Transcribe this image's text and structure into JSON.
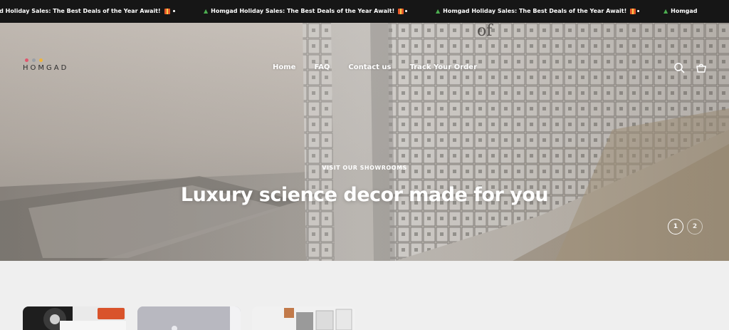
{
  "announcement": {
    "items": [
      {
        "text": "gad Holiday Sales: The Best Deals of the Year Await!"
      },
      {
        "text": "Homgad Holiday Sales: The Best Deals of the Year Await!"
      },
      {
        "text": "Homgad Holiday Sales: The Best Deals of the Year Await!"
      },
      {
        "text": "Homgad"
      }
    ]
  },
  "header": {
    "logo_text": "HOMGAD",
    "logo_dot_colors": [
      "#e0566d",
      "#9aa0a6",
      "#f0b43c"
    ],
    "nav": [
      {
        "label": "Home"
      },
      {
        "label": "FAQ"
      },
      {
        "label": "Contact us"
      },
      {
        "label": "Track Your Order"
      }
    ],
    "icons": [
      "search-icon",
      "cart-icon"
    ]
  },
  "hero": {
    "eyebrow": "VISIT OUR SHOWROOMS",
    "headline": "Luxury science decor made for you",
    "slides": [
      {
        "label": "1",
        "active": true
      },
      {
        "label": "2",
        "active": false
      }
    ]
  }
}
